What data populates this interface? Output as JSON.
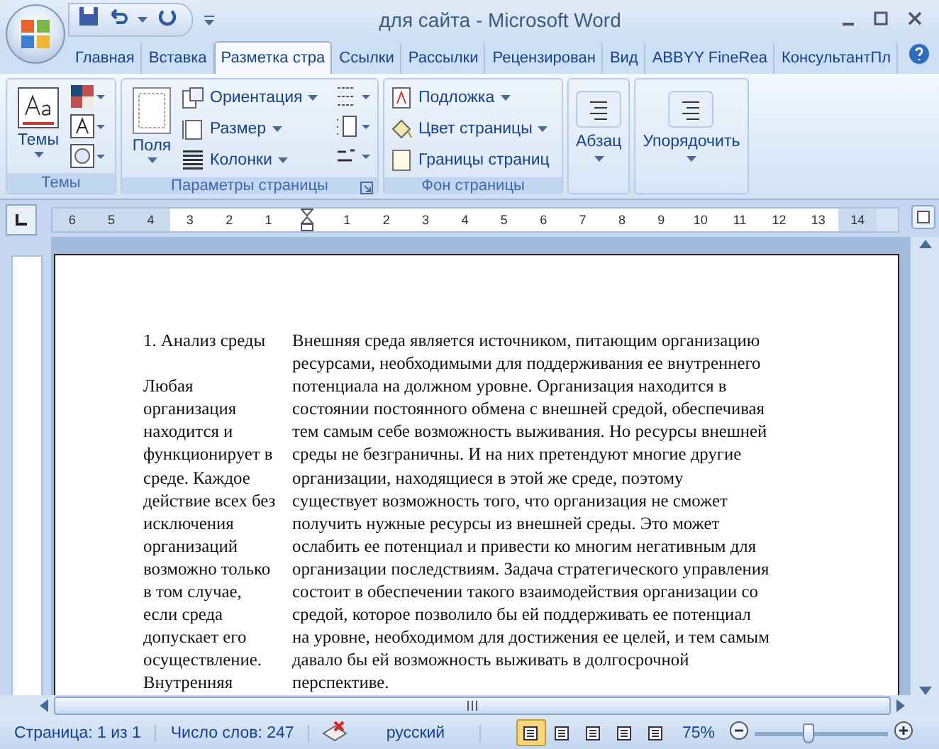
{
  "window": {
    "title": "для сайта - Microsoft Word"
  },
  "tabs": [
    {
      "label": "Главная",
      "selected": false
    },
    {
      "label": "Вставка",
      "selected": false
    },
    {
      "label": "Разметка стра",
      "selected": true
    },
    {
      "label": "Ссылки",
      "selected": false
    },
    {
      "label": "Рассылки",
      "selected": false
    },
    {
      "label": "Рецензирован",
      "selected": false
    },
    {
      "label": "Вид",
      "selected": false
    },
    {
      "label": "ABBYY FineRea",
      "selected": false
    },
    {
      "label": "КонсультантПл",
      "selected": false
    }
  ],
  "ribbon": {
    "groups": [
      {
        "kind": "themes",
        "title": "Темы",
        "big_button": "Темы"
      },
      {
        "kind": "page_setup",
        "title": "Параметры страницы",
        "big_button": "Поля",
        "commands": [
          {
            "label": "Ориентация",
            "has_menu": true
          },
          {
            "label": "Размер",
            "has_menu": true
          },
          {
            "label": "Колонки",
            "has_menu": true
          }
        ]
      },
      {
        "kind": "background",
        "title": "Фон страницы",
        "commands": [
          {
            "label": "Подложка",
            "has_menu": true
          },
          {
            "label": "Цвет страницы",
            "has_menu": true
          },
          {
            "label": "Границы страниц",
            "has_menu": false
          }
        ]
      },
      {
        "kind": "collapsed",
        "big_button": "Абзац"
      },
      {
        "kind": "collapsed",
        "big_button": "Упорядочить"
      }
    ]
  },
  "ruler": {
    "labels": [
      {
        "text": "6",
        "margin": true
      },
      {
        "text": "5",
        "margin": true
      },
      {
        "text": "4",
        "margin": true
      },
      {
        "text": "3",
        "margin": false
      },
      {
        "text": "2",
        "margin": false
      },
      {
        "text": "1",
        "margin": false
      },
      {
        "kind": "indent_marker",
        "margin": false
      },
      {
        "text": "1",
        "margin": false
      },
      {
        "text": "2",
        "margin": false
      },
      {
        "text": "3",
        "margin": false
      },
      {
        "text": "4",
        "margin": false
      },
      {
        "text": "5",
        "margin": false
      },
      {
        "text": "6",
        "margin": false
      },
      {
        "text": "7",
        "margin": false
      },
      {
        "text": "8",
        "margin": false
      },
      {
        "text": "9",
        "margin": false
      },
      {
        "text": "10",
        "margin": false
      },
      {
        "text": "11",
        "margin": false
      },
      {
        "text": "12",
        "margin": false
      },
      {
        "text": "13",
        "margin": false
      },
      {
        "text": "14",
        "margin": true
      }
    ]
  },
  "document": {
    "left_cell": [
      [
        "1. Анализ среды"
      ],
      [
        "Любая",
        "организация",
        "находится и",
        "функционирует в",
        "среде. Каждое",
        "действие всех без",
        "исключения",
        "организаций",
        "возможно только",
        "в том случае,",
        "если среда",
        "допускает его",
        "осуществление.",
        "Внутренняя"
      ]
    ],
    "right_cell": [
      "Внешняя  среда является источником, питающим организацию",
      "ресурсами, необходимыми для поддерживания ее внутреннего",
      "потенциала на должном уровне. Организация находится в",
      "состоянии постоянного обмена с внешней средой, обеспечивая",
      "тем самым себе возможность выживания. Но ресурсы внешней",
      "среды не безграничны. И на них претендуют многие другие",
      "организации, находящиеся в этой же среде, поэтому",
      "существует возможность того, что организация не сможет",
      "получить нужные ресурсы из внешней среды. Это может",
      "ослабить ее потенциал и привести ко многим негативным для",
      "организации последствиям. Задача стратегического управления",
      "состоит в обеспечении такого взаимодействия организации со",
      "средой, которое позволило бы ей поддерживать ее потенциал",
      "на уровне, необходимом для достижения ее целей, и тем самым",
      "давало бы ей возможность выживать в долгосрочной",
      "перспективе."
    ]
  },
  "status_bar": {
    "page": "Страница: 1 из 1",
    "words": "Число слов: 247",
    "language": "русский",
    "views": [
      {
        "selected": true
      },
      {
        "selected": false
      },
      {
        "selected": false
      },
      {
        "selected": false
      },
      {
        "selected": false
      }
    ],
    "zoom": "75%",
    "zoom_slider": {
      "level": 0.4
    }
  }
}
